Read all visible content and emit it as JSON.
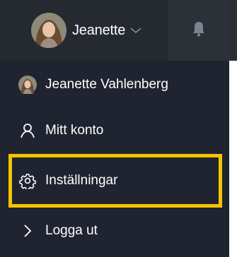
{
  "header": {
    "user_name": "Jeanette",
    "avatar_icon": "avatar-photo",
    "chevron_icon": "chevron-down-icon",
    "bell_icon": "bell-icon"
  },
  "menu": {
    "items": [
      {
        "label": "Jeanette Vahlenberg",
        "icon": "avatar-photo"
      },
      {
        "label": "Mitt konto",
        "icon": "user-icon"
      },
      {
        "label": "Inställningar",
        "icon": "gear-icon"
      },
      {
        "label": "Logga ut",
        "icon": "chevron-right-icon"
      }
    ]
  },
  "colors": {
    "topbar": "#2a2f36",
    "menu_bg": "#1f2430",
    "highlight": "#f5c400",
    "text": "#ffffff"
  }
}
